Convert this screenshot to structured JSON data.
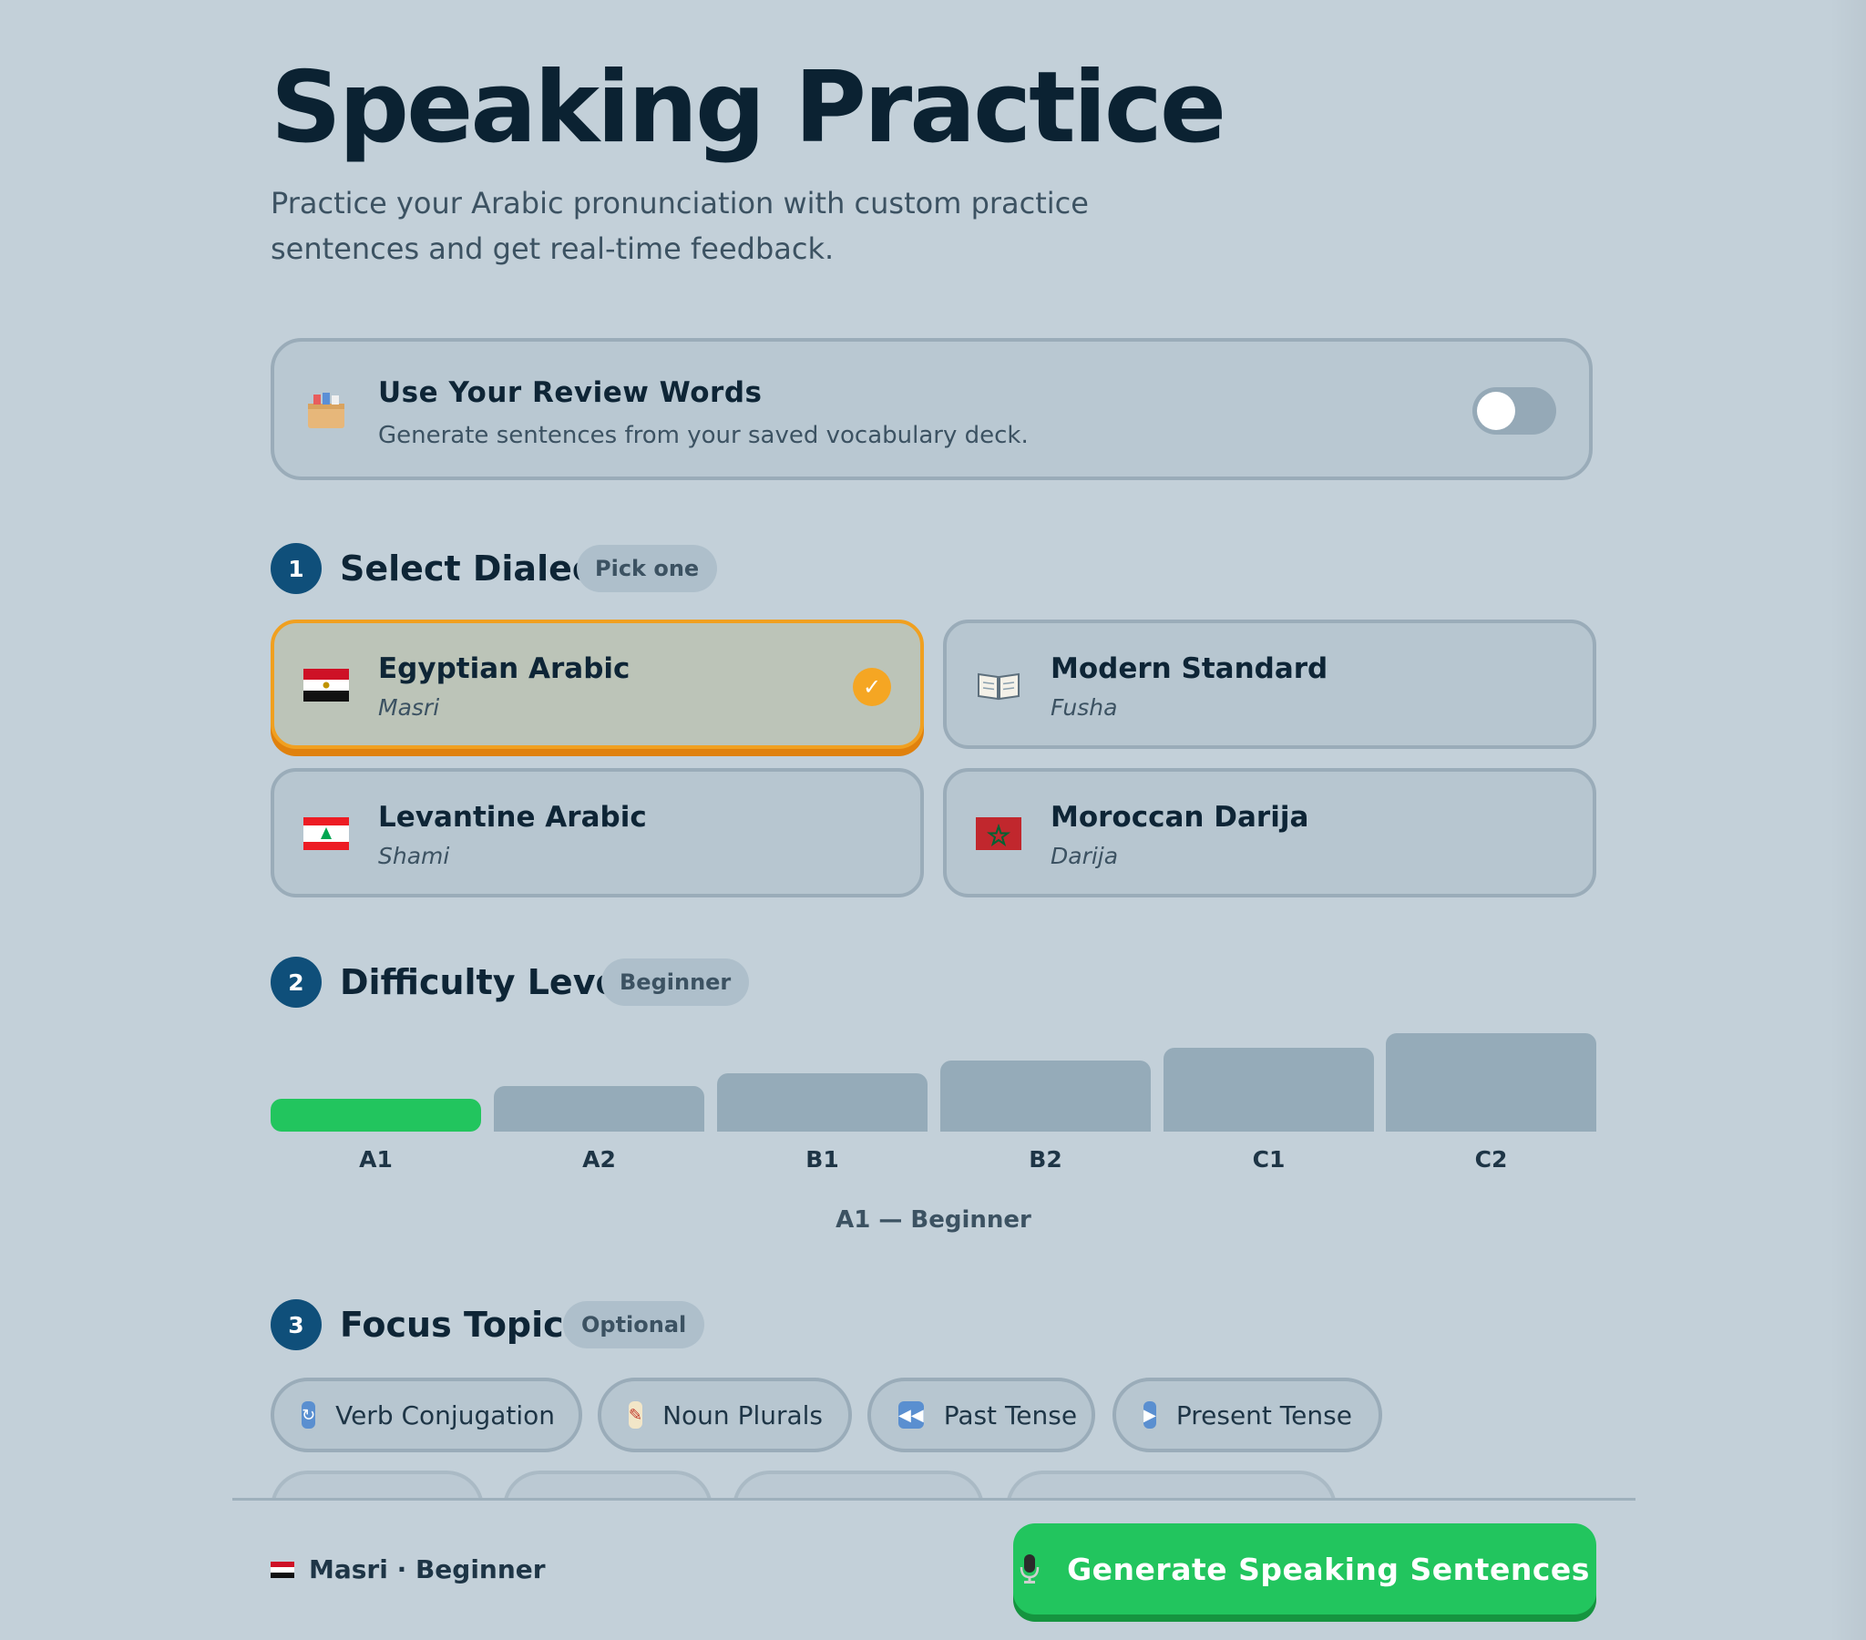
{
  "header": {
    "title": "Speaking Practice",
    "subtitle": "Practice your Arabic pronunciation with custom practice sentences and get real-time feedback."
  },
  "review_words": {
    "icon": "card-box-icon",
    "title": "Use Your Review Words",
    "description": "Generate sentences from your saved vocabulary deck.",
    "enabled": false
  },
  "dialect_section": {
    "step": "1",
    "title": "Select Dialect",
    "chip": "Pick one",
    "options": [
      {
        "name": "Egyptian Arabic",
        "sub": "Masri",
        "icon": "egypt-flag-icon",
        "selected": true
      },
      {
        "name": "Modern Standard",
        "sub": "Fusha",
        "icon": "open-book-icon",
        "selected": false
      },
      {
        "name": "Levantine Arabic",
        "sub": "Shami",
        "icon": "lebanon-flag-icon",
        "selected": false
      },
      {
        "name": "Moroccan Darija",
        "sub": "Darija",
        "icon": "morocco-flag-icon",
        "selected": false
      }
    ],
    "check_glyph": "✓"
  },
  "difficulty_section": {
    "step": "2",
    "title": "Difficulty Level",
    "chip": "Beginner",
    "levels": [
      "A1",
      "A2",
      "B1",
      "B2",
      "C1",
      "C2"
    ],
    "selected_level": "A1",
    "selected_text": "A1 — Beginner"
  },
  "topics_section": {
    "step": "3",
    "title": "Focus Topics",
    "chip": "Optional",
    "topics": [
      {
        "label": "Verb Conjugation",
        "icon": "cycle-arrows-icon",
        "color": "#5a8fd0"
      },
      {
        "label": "Noun Plurals",
        "icon": "memo-icon",
        "color": "#f2e6c8"
      },
      {
        "label": "Past Tense",
        "icon": "rewind-icon",
        "color": "#5a8fd0"
      },
      {
        "label": "Present Tense",
        "icon": "play-icon",
        "color": "#5a8fd0"
      }
    ]
  },
  "footer": {
    "summary": "Masri · Beginner",
    "summary_icon": "egypt-flag-icon",
    "generate_label": "Generate Speaking Sentences",
    "generate_icon": "microphone-icon",
    "accent": "#22c55e"
  }
}
